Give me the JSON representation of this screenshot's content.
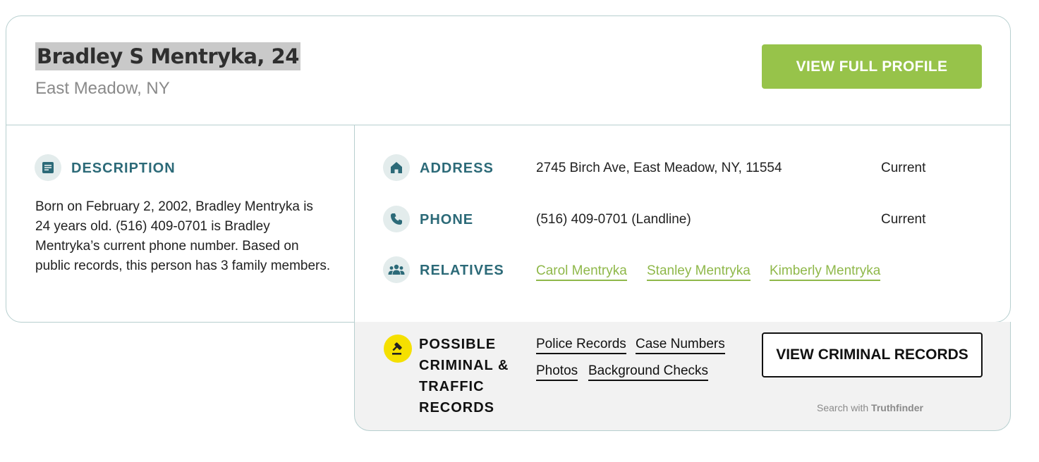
{
  "profile": {
    "name": "Bradley S Mentryka, 24",
    "location": "East Meadow, NY",
    "view_full_profile_label": "VIEW FULL PROFILE"
  },
  "description": {
    "label": "DESCRIPTION",
    "text": "Born on February 2, 2002, Bradley Mentryka is 24 years old. (516) 409-0701 is Bradley Mentryka’s current phone number. Based on public records, this person has 3 family members."
  },
  "address": {
    "label": "ADDRESS",
    "value": "2745 Birch Ave, East Meadow, NY, 11554",
    "status": "Current"
  },
  "phone": {
    "label": "PHONE",
    "value": "(516) 409-0701 (Landline)",
    "status": "Current"
  },
  "relatives": {
    "label": "RELATIVES",
    "items": [
      "Carol Mentryka",
      "Stanley Mentryka",
      "Kimberly Mentryka"
    ]
  },
  "criminal": {
    "title_lines": [
      "POSSIBLE",
      "CRIMINAL &",
      "TRAFFIC",
      "RECORDS"
    ],
    "links": [
      "Police Records",
      "Case Numbers",
      "Photos",
      "Background Checks"
    ],
    "button_label": "VIEW CRIMINAL RECORDS",
    "search_with_prefix": "Search with",
    "search_with_brand": "Truthfinder"
  },
  "colors": {
    "accent_green": "#97c34a",
    "label_teal": "#2c6a78",
    "link_green": "#8fb84a",
    "criminal_icon_yellow": "#f5e000"
  },
  "icons": {
    "description": "document-icon",
    "address": "home-icon",
    "phone": "phone-icon",
    "relatives": "people-icon",
    "criminal": "gavel-icon"
  }
}
